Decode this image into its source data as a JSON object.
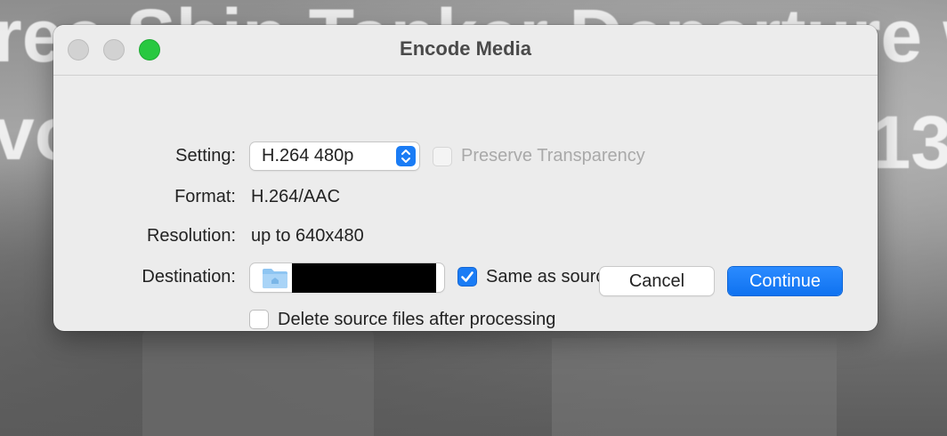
{
  "background": {
    "line1": "ree Ship Tanker Departure w",
    "line2": "vo",
    "right": "-13"
  },
  "window": {
    "title": "Encode Media"
  },
  "form": {
    "setting_label": "Setting:",
    "setting_value": "H.264 480p",
    "preserve_transparency_label": "Preserve Transparency",
    "preserve_transparency_checked": false,
    "preserve_transparency_enabled": false,
    "format_label": "Format:",
    "format_value": "H.264/AAC",
    "resolution_label": "Resolution:",
    "resolution_value": "up to 640x480",
    "destination_label": "Destination:",
    "same_as_source_label": "Same as source file",
    "same_as_source_checked": true,
    "delete_source_label": "Delete source files after processing",
    "delete_source_checked": false
  },
  "buttons": {
    "cancel": "Cancel",
    "continue": "Continue"
  },
  "icons": {
    "stepper": "chevron-up-down-icon",
    "folder": "folder-icon",
    "check": "checkmark-icon"
  },
  "colors": {
    "accent": "#1a7cf5",
    "zoom_button": "#28c840"
  }
}
